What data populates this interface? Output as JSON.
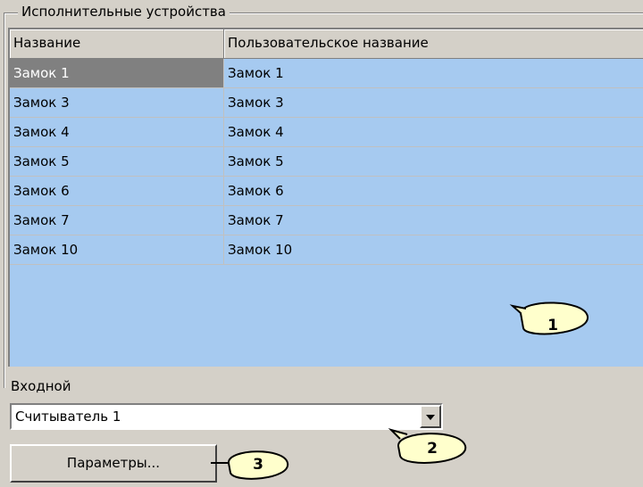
{
  "group": {
    "title": "Исполнительные устройства"
  },
  "table": {
    "columns": [
      "Название",
      "Пользовательское название"
    ],
    "rows": [
      [
        "Замок 1",
        "Замок 1"
      ],
      [
        "Замок 3",
        "Замок 3"
      ],
      [
        "Замок 4",
        "Замок 4"
      ],
      [
        "Замок 5",
        "Замок 5"
      ],
      [
        "Замок 6",
        "Замок 6"
      ],
      [
        "Замок 7",
        "Замок 7"
      ],
      [
        "Замок 10",
        "Замок 10"
      ]
    ],
    "selected_row": 0
  },
  "input": {
    "label": "Входной",
    "value": "Считыватель 1"
  },
  "params_button": "Параметры...",
  "callouts": [
    "1",
    "2",
    "3"
  ],
  "colors": {
    "grid_background": "#a6caf0",
    "selected_cell": "#808080",
    "window_background": "#d4d0c8"
  }
}
